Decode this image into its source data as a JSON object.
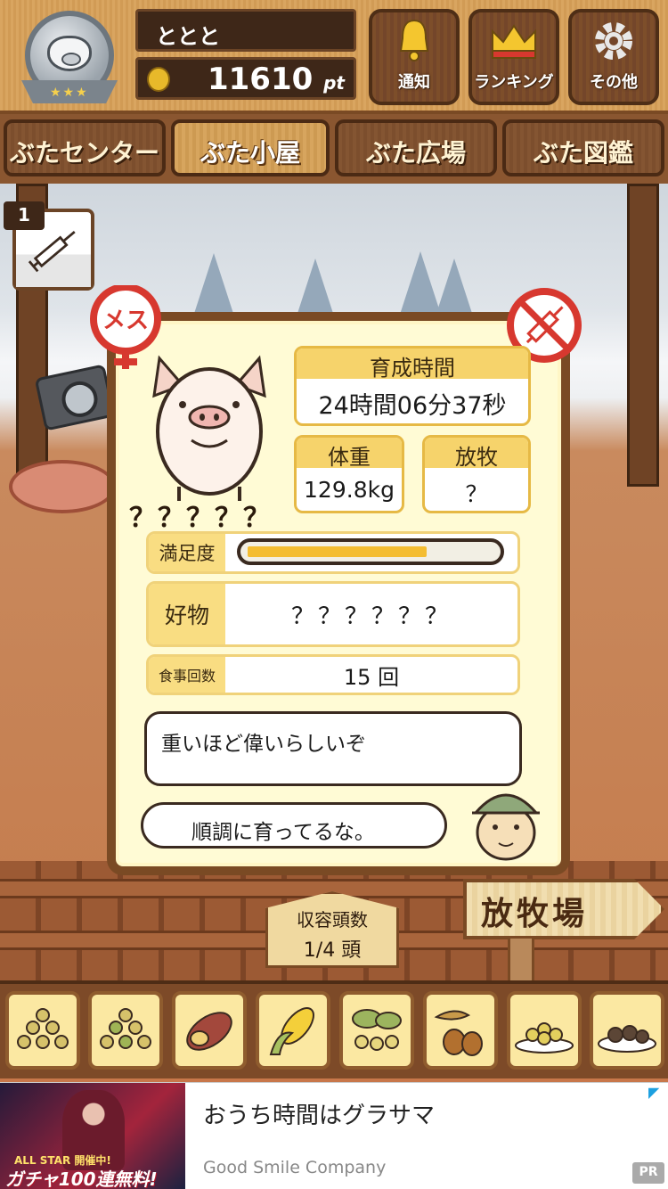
{
  "header": {
    "username": "ととと",
    "points_value": "11610",
    "points_unit": "pt",
    "buttons": [
      {
        "label": "通知",
        "icon": "bell-icon"
      },
      {
        "label": "ランキング",
        "icon": "crown-icon"
      },
      {
        "label": "その他",
        "icon": "gear-icon"
      }
    ]
  },
  "tabs": [
    {
      "label": "ぶたセンター",
      "active": false
    },
    {
      "label": "ぶた小屋",
      "active": true
    },
    {
      "label": "ぶた広場",
      "active": false
    },
    {
      "label": "ぶた図鑑",
      "active": false
    }
  ],
  "item_card": {
    "count": "1",
    "icon": "syringe-icon"
  },
  "pig": {
    "name": "？？？？？",
    "gender_label": "メス",
    "growth_time_label": "育成時間",
    "growth_time_value": "24時間06分37秒",
    "weight_label": "体重",
    "weight_value": "129.8kg",
    "grazing_label": "放牧",
    "grazing_value": "？",
    "satisfaction_label": "満足度",
    "satisfaction_level": 0.73,
    "favorite_label": "好物",
    "favorite_value": "？？？？？？",
    "meals_label": "食事回数",
    "meals_value": "15 回"
  },
  "messages": {
    "top": "重いほど偉いらしいぞ",
    "bottom": "順調に育ってるな。"
  },
  "capacity": {
    "label": "収容頭数",
    "value": "1/4 頭"
  },
  "pasture_sign": "放牧場",
  "foods": [
    "grain-pile-icon",
    "mixed-grain-icon",
    "sweet-potato-icon",
    "corn-icon",
    "soybean-icon",
    "acorn-icon",
    "grain-plate-icon",
    "rice-ball-plate-icon"
  ],
  "ad": {
    "title": "おうち時間はグラサマ",
    "advertiser": "Good Smile Company",
    "banner_line1": "ALL STAR 開催中!",
    "banner_line2": "ガチャ100連無料!",
    "pr": "PR"
  },
  "colors": {
    "wood_dark": "#7a4a24",
    "card_bg": "#fffbd5",
    "accent_yellow": "#f6d36b",
    "gender_red": "#d7382f"
  }
}
